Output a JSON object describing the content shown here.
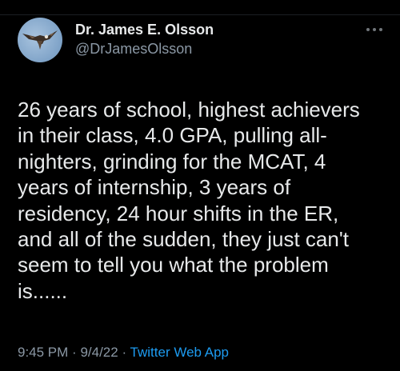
{
  "author": {
    "display_name": "Dr. James E. Olsson",
    "handle": "@DrJamesOlsson",
    "avatar_icon": "bird-in-flight-avatar"
  },
  "more_icon": "more-horizontal-icon",
  "tweet": {
    "lines": [
      "26 years of school, highest achievers",
      "in their class, 4.0 GPA, pulling all-",
      "nighters, grinding for the MCAT, 4",
      "years of internship, 3 years of",
      "residency, 24 hour shifts in the ER,",
      "and all of the sudden, they just can't",
      "seem to tell you what the problem",
      "is......"
    ]
  },
  "meta": {
    "time": "9:45 PM",
    "separator": "·",
    "date": "9/4/22",
    "source": "Twitter Web App"
  },
  "colors": {
    "background": "#000000",
    "text_primary": "#e7e9ea",
    "text_secondary": "#8b98a5",
    "link": "#1d9bf0"
  }
}
